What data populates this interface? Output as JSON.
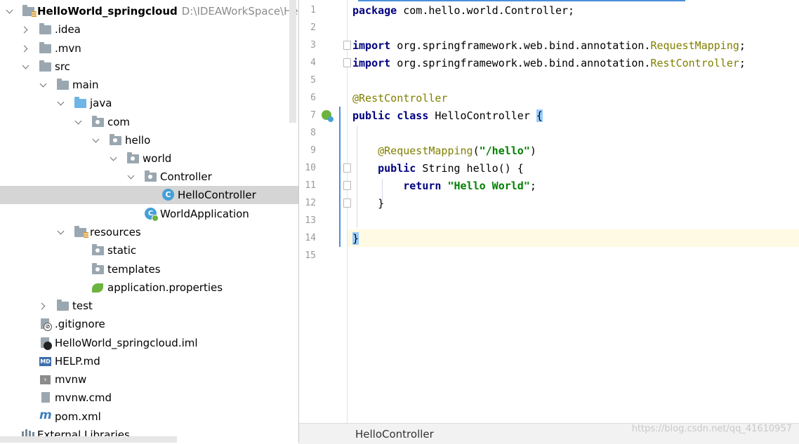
{
  "project_tree": {
    "root": {
      "label": "HelloWorld_springcloud",
      "path": "D:\\IDEAWorkSpace\\Hello"
    },
    "items": [
      {
        "label": ".idea"
      },
      {
        "label": ".mvn"
      },
      {
        "label": "src"
      },
      {
        "label": "main"
      },
      {
        "label": "java"
      },
      {
        "label": "com"
      },
      {
        "label": "hello"
      },
      {
        "label": "world"
      },
      {
        "label": "Controller"
      },
      {
        "label": "HelloController"
      },
      {
        "label": "WorldApplication"
      },
      {
        "label": "resources"
      },
      {
        "label": "static"
      },
      {
        "label": "templates"
      },
      {
        "label": "application.properties"
      },
      {
        "label": "test"
      },
      {
        "label": ".gitignore"
      },
      {
        "label": "HelloWorld_springcloud.iml"
      },
      {
        "label": "HELP.md"
      },
      {
        "label": "mvnw"
      },
      {
        "label": "mvnw.cmd"
      },
      {
        "label": "pom.xml"
      },
      {
        "label": "External Libraries"
      }
    ],
    "selected_item": "HelloController"
  },
  "editor": {
    "line_numbers": [
      "1",
      "2",
      "3",
      "4",
      "5",
      "6",
      "7",
      "8",
      "9",
      "10",
      "11",
      "12",
      "13",
      "14",
      "15"
    ],
    "code": {
      "l1_kw": "package",
      "l1_rest": " com.hello.world.Controller;",
      "l3_kw": "import",
      "l3_pkg": " org.springframework.web.bind.annotation.",
      "l3_cls": "RequestMapping",
      "l3_end": ";",
      "l4_kw": "import",
      "l4_pkg": " org.springframework.web.bind.annotation.",
      "l4_cls": "RestController",
      "l4_end": ";",
      "l6_anno": "@RestController",
      "l7_kw": "public class",
      "l7_rest": " HelloController ",
      "l7_brace": "{",
      "l9_anno": "@RequestMapping",
      "l9_open": "(",
      "l9_str": "\"/hello\"",
      "l9_close": ")",
      "l10_kw": "public",
      "l10_rest": " String hello() {",
      "l11_kw": "return",
      "l11_sp": " ",
      "l11_str": "\"Hello World\"",
      "l11_end": ";",
      "l12": "}",
      "l14": "}"
    },
    "current_line": "14"
  },
  "breadcrumb": {
    "label": "HelloController"
  },
  "watermark": "https://blog.csdn.net/qq_41610957",
  "colors": {
    "keyword": "#000080",
    "annotation": "#808000",
    "string": "#008000",
    "selection": "#d5d5d5",
    "current_line": "#fffae3"
  }
}
